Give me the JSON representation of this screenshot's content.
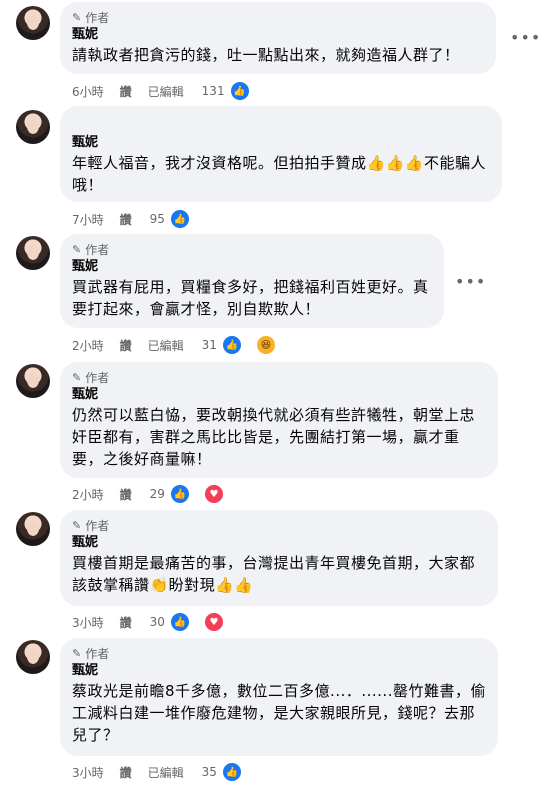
{
  "author_badge": "作者",
  "comments": [
    {
      "name": "甄妮",
      "text": "請執政者把貪污的錢，吐一點點出來，就夠造福人群了！",
      "time": "6小時",
      "reply": "讚",
      "edited": "已編輯",
      "count": "131",
      "reactions": [
        "like"
      ],
      "menu": "•••"
    },
    {
      "name": "甄妮",
      "text": "年輕人福音，我才沒資格呢。但拍拍手贊成👍👍👍不能騙人哦！",
      "time": "7小時",
      "reply": "讚",
      "edited": "",
      "count": "95",
      "reactions": [
        "like"
      ]
    },
    {
      "name": "甄妮",
      "text": "買武器有屁用，買糧食多好，把錢福利百姓更好。真要打起來，會贏才怪，別自欺欺人！",
      "time": "2小時",
      "reply": "讚",
      "edited": "已編輯",
      "count": "31",
      "reactions": [
        "like",
        "haha"
      ],
      "menu": "•••"
    },
    {
      "name": "甄妮",
      "text": "仍然可以藍白恊，要改朝換代就必須有些許犧牲，朝堂上忠奸臣都有，害群之馬比比皆是，先團結打第一場，贏才重要，之後好商量嘛！",
      "time": "2小時",
      "reply": "讚",
      "edited": "",
      "count": "29",
      "reactions": [
        "like",
        "love"
      ]
    },
    {
      "name": "甄妮",
      "text": "買樓首期是最痛苦的事，台灣提出青年買樓免首期，大家都該鼓掌稱讚👏盼對現👍👍",
      "time": "3小時",
      "reply": "讚",
      "edited": "",
      "count": "30",
      "reactions": [
        "like",
        "love"
      ]
    },
    {
      "name": "甄妮",
      "text": "蔡政光是前瞻8千多億，數位二百多億...．......罄竹難書，偷工減料白建一堆作廢危建物，是大家親眼所見，錢呢？去那兒了？",
      "time": "3小時",
      "reply": "讚",
      "edited": "已編輯",
      "count": "35",
      "reactions": [
        "like"
      ]
    }
  ]
}
